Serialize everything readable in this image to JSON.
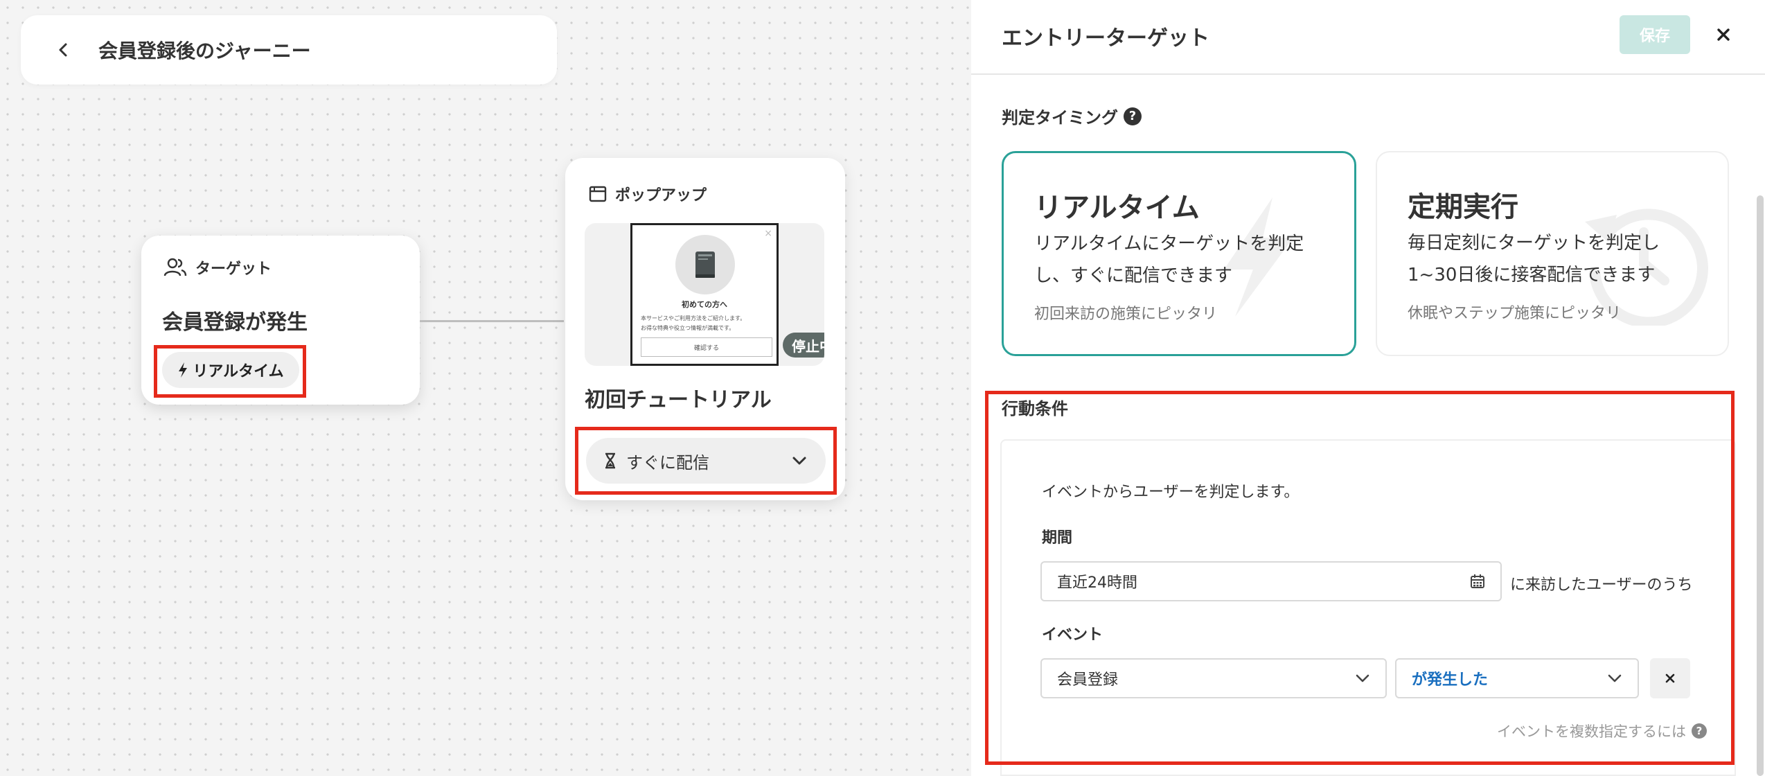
{
  "journey": {
    "title": "会員登録後のジャーニー"
  },
  "target_node": {
    "header": "ターゲット",
    "title": "会員登録が発生",
    "badge": "リアルタイム"
  },
  "popup_node": {
    "header": "ポップアップ",
    "preview": {
      "close": "×",
      "title": "初めての方へ",
      "text_line1": "本サービスやご利用方法をご紹介します。",
      "text_line2": "お得な特典や役立つ情報が満載です。",
      "button": "確認する"
    },
    "status_badge": "停止中",
    "title": "初回チュートリアル",
    "delivery": "すぐに配信"
  },
  "panel": {
    "title": "エントリーターゲット",
    "save_label": "保存",
    "timing_label": "判定タイミング",
    "timing_options": [
      {
        "title": "リアルタイム",
        "desc_line1": "リアルタイムにターゲットを判定",
        "desc_line2": "し、すぐに配信できます",
        "hint": "初回来訪の施策にピッタリ",
        "selected": true
      },
      {
        "title": "定期実行",
        "desc_line1": "毎日定刻にターゲットを判定し",
        "desc_line2": "1~30日後に接客配信できます",
        "hint": "休眠やステップ施策にピッタリ",
        "selected": false
      }
    ],
    "behavior": {
      "label": "行動条件",
      "description": "イベントからユーザーを判定します。",
      "period_label": "期間",
      "period_value": "直近24時間",
      "period_suffix": "に来訪したユーザーのうち",
      "event_label": "イベント",
      "event_value": "会員登録",
      "event_condition": "が発生した",
      "multi_hint": "イベントを複数指定するには"
    }
  },
  "colors": {
    "accent_teal": "#2aa198",
    "highlight_red": "#e52a1b",
    "save_disabled": "#c9e7e2",
    "link_blue": "#1a6fbf"
  }
}
